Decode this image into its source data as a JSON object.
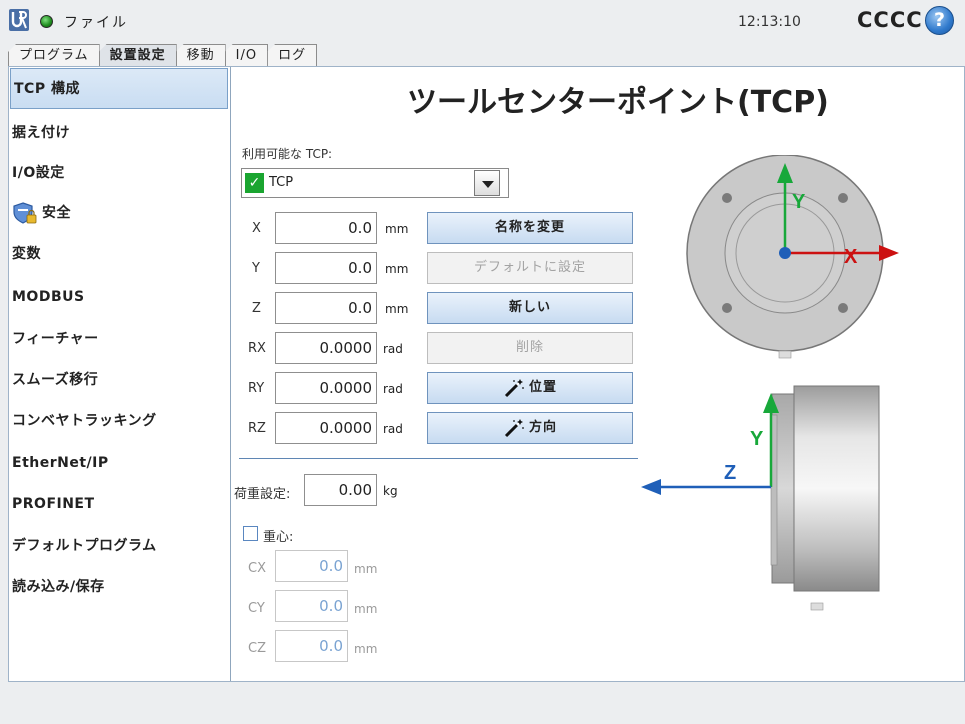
{
  "app": {
    "file_menu": "ファイル",
    "clock": "12:13:10",
    "robot_name": "CCCC",
    "help_label": "?"
  },
  "tabs": [
    {
      "label": "プログラム"
    },
    {
      "label": "設置設定",
      "active": true
    },
    {
      "label": "移動"
    },
    {
      "label": "I/O"
    },
    {
      "label": "ログ"
    }
  ],
  "sidebar": {
    "items": [
      {
        "label": "TCP 構成",
        "active": true
      },
      {
        "label": "据え付け"
      },
      {
        "label": "I/O設定"
      },
      {
        "label": "安全",
        "icon": "safety-shield-lock-icon"
      },
      {
        "label": "変数"
      },
      {
        "label": "MODBUS"
      },
      {
        "label": "フィーチャー"
      },
      {
        "label": "スムーズ移行"
      },
      {
        "label": "コンベヤトラッキング"
      },
      {
        "label": "EtherNet/IP"
      },
      {
        "label": "PROFINET"
      },
      {
        "label": "デフォルトプログラム"
      },
      {
        "label": "読み込み/保存"
      }
    ]
  },
  "main": {
    "title": "ツールセンターポイント(TCP)",
    "available_tcp_label": "利用可能な TCP:",
    "selected_tcp": "TCP",
    "fields": [
      {
        "label": "X",
        "value": "0.0",
        "unit": "mm"
      },
      {
        "label": "Y",
        "value": "0.0",
        "unit": "mm"
      },
      {
        "label": "Z",
        "value": "0.0",
        "unit": "mm"
      },
      {
        "label": "RX",
        "value": "0.0000",
        "unit": "rad"
      },
      {
        "label": "RY",
        "value": "0.0000",
        "unit": "rad"
      },
      {
        "label": "RZ",
        "value": "0.0000",
        "unit": "rad"
      }
    ],
    "buttons": {
      "rename": "名称を変更",
      "set_default": "デフォルトに設定",
      "new": "新しい",
      "delete": "削除",
      "position": "位置",
      "orientation": "方向"
    },
    "payload_label": "荷重設定:",
    "payload_value": "0.00",
    "payload_unit": "kg",
    "cog_label": "重心:",
    "cog_checked": false,
    "cog_fields": [
      {
        "label": "CX",
        "value": "0.0",
        "unit": "mm"
      },
      {
        "label": "CY",
        "value": "0.0",
        "unit": "mm"
      },
      {
        "label": "CZ",
        "value": "0.0",
        "unit": "mm"
      }
    ],
    "drawing": {
      "axis_x": "X",
      "axis_y": "Y",
      "axis_z": "Z",
      "colors": {
        "x": "#cc1111",
        "y": "#18a83a",
        "z": "#1f5fb8"
      }
    }
  }
}
